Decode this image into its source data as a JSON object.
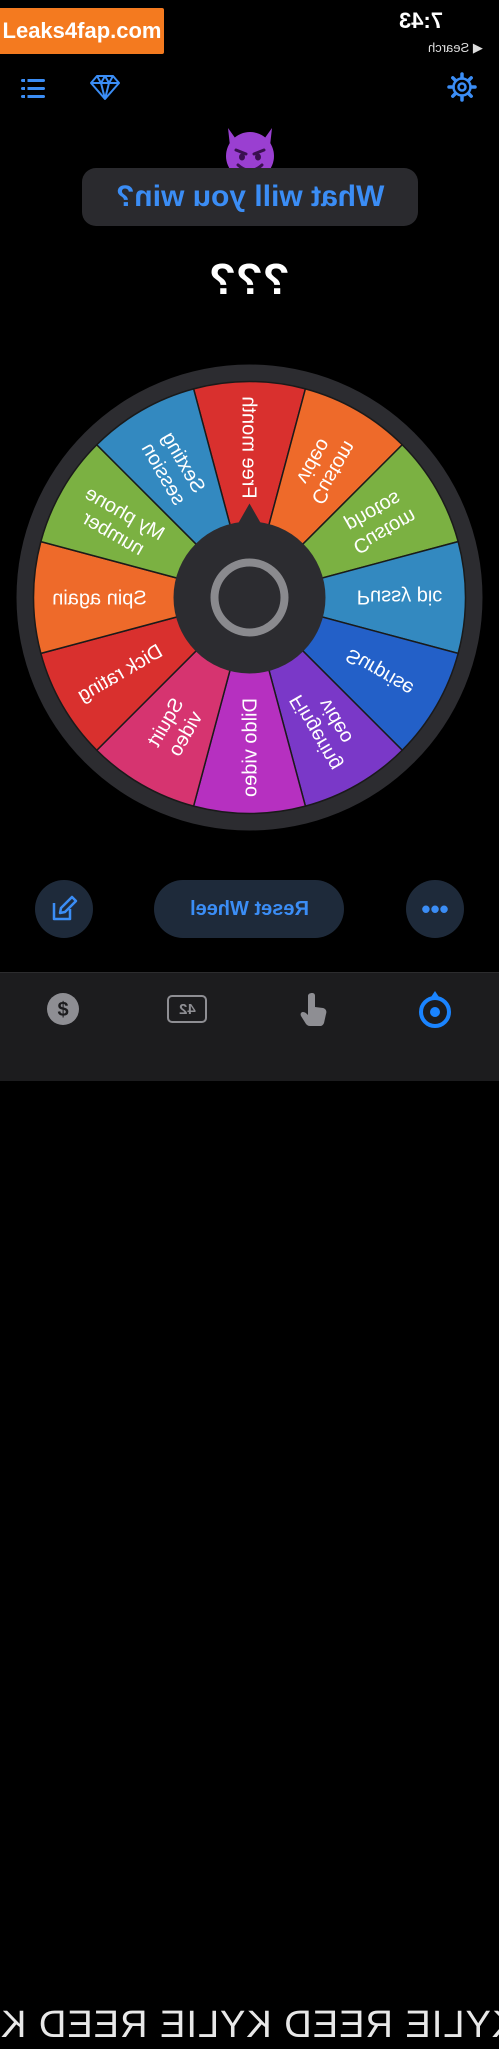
{
  "watermark": "Leaks4fap.com",
  "status": {
    "time": "7:43",
    "back_label": "◀ Search"
  },
  "header": {
    "title": "What will you win?",
    "result": "???"
  },
  "wheel": {
    "segments": [
      {
        "label": "Free month",
        "color": "#d9302e"
      },
      {
        "label": "Custom video",
        "color": "#ee6a2a"
      },
      {
        "label": "Custom photos",
        "color": "#7bb142"
      },
      {
        "label": "Pussy pic",
        "color": "#3389c0"
      },
      {
        "label": "Surprise",
        "color": "#2360c8"
      },
      {
        "label": "Fingering video",
        "color": "#7a38c8"
      },
      {
        "label": "Dildo video",
        "color": "#b630c0"
      },
      {
        "label": "Squirt video",
        "color": "#d63470"
      },
      {
        "label": "Dick rating",
        "color": "#d9302e"
      },
      {
        "label": "Spin again",
        "color": "#ee6a2a"
      },
      {
        "label": "My phone number",
        "color": "#7bb142"
      },
      {
        "label": "Sexting session",
        "color": "#3389c0"
      }
    ]
  },
  "controls": {
    "reset_label": "Reset Wheel",
    "more_label": "•••"
  },
  "tabbar": {
    "count": "42",
    "active_color": "#1a84ff",
    "inactive_color": "#8e8e93"
  },
  "footer_text": "KYLIE REED KYLIE REED KYLIE REED K"
}
